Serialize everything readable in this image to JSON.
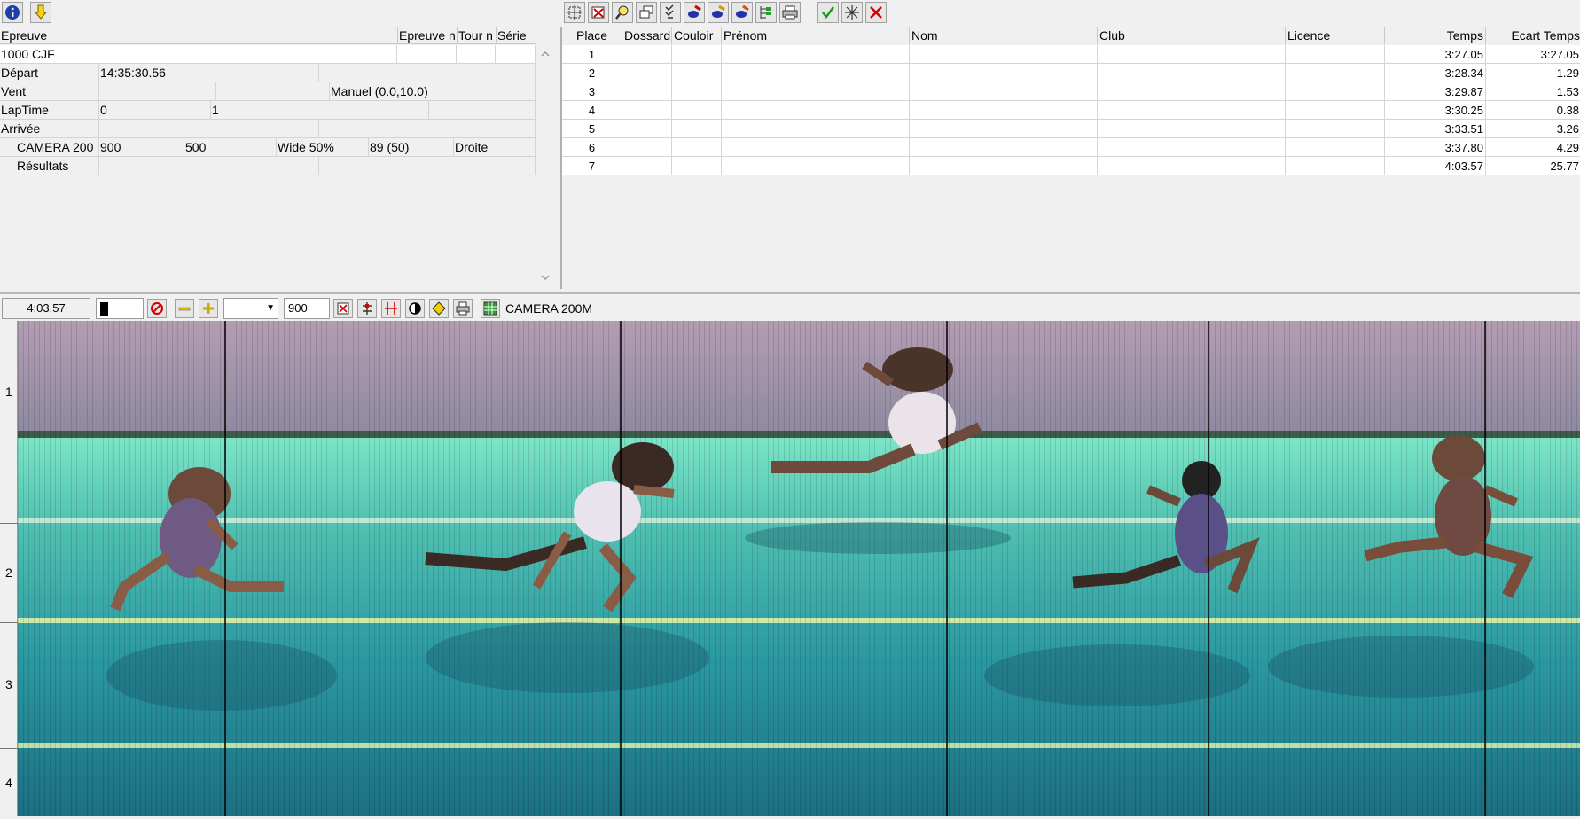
{
  "top_toolbar_left": {
    "buttons": [
      {
        "name": "info-icon"
      },
      {
        "name": "down-arrow-icon"
      }
    ]
  },
  "left_grid": {
    "headers": {
      "epreuve": "Epreuve",
      "epreuve_n": "Epreuve n",
      "tour_n": "Tour n",
      "serie": "Série"
    },
    "rows": [
      {
        "label": "1000 CJF",
        "v1": "",
        "v2": ""
      },
      {
        "label": "Départ",
        "v1": "14:35:30.56",
        "v2": ""
      },
      {
        "label": "Vent",
        "v1": "",
        "v2": "Manuel (0.0,10.0)"
      },
      {
        "label": "LapTime",
        "v1": "0",
        "v2": "1"
      },
      {
        "label": "Arrivée",
        "v1": "",
        "v2": ""
      }
    ],
    "camera_row": {
      "label": "CAMERA 200",
      "c1": "900",
      "c2": "500",
      "c3": "Wide 50%",
      "c4": "89  (50)",
      "c5": "Droite"
    },
    "results_row": {
      "label": "Résultats"
    }
  },
  "right_toolbar": {
    "buttons": [
      "grid-select-icon",
      "delete-icon",
      "zoom-icon",
      "windows-icon",
      "check-list-icon",
      "edit-red-icon",
      "edit-blue-icon",
      "edit-green-icon",
      "tree-icon",
      "print-icon",
      "accept-icon",
      "sparkle-icon",
      "reject-icon"
    ]
  },
  "results_table": {
    "headers": {
      "place": "Place",
      "dossard": "Dossard",
      "couloir": "Couloir",
      "prenom": "Prénom",
      "nom": "Nom",
      "club": "Club",
      "licence": "Licence",
      "temps": "Temps",
      "ecart": "Ecart Temps"
    },
    "rows": [
      {
        "place": "1",
        "temps": "3:27.05",
        "ecart": "3:27.05"
      },
      {
        "place": "2",
        "temps": "3:28.34",
        "ecart": "1.29"
      },
      {
        "place": "3",
        "temps": "3:29.87",
        "ecart": "1.53"
      },
      {
        "place": "4",
        "temps": "3:30.25",
        "ecart": "0.38"
      },
      {
        "place": "5",
        "temps": "3:33.51",
        "ecart": "3.26"
      },
      {
        "place": "6",
        "temps": "3:37.80",
        "ecart": "4.29"
      },
      {
        "place": "7",
        "temps": "4:03.57",
        "ecart": "25.77"
      }
    ]
  },
  "lower_toolbar": {
    "time_value": "4:03.57",
    "zoom_value": "900",
    "camera_label": "CAMERA 200M"
  },
  "photo": {
    "lanes": [
      "1",
      "2",
      "3",
      "4"
    ]
  },
  "colors": {
    "track_top": "#a08ba0",
    "track_lane": "#5fc6b3",
    "track_dark": "#1f7d8c"
  }
}
